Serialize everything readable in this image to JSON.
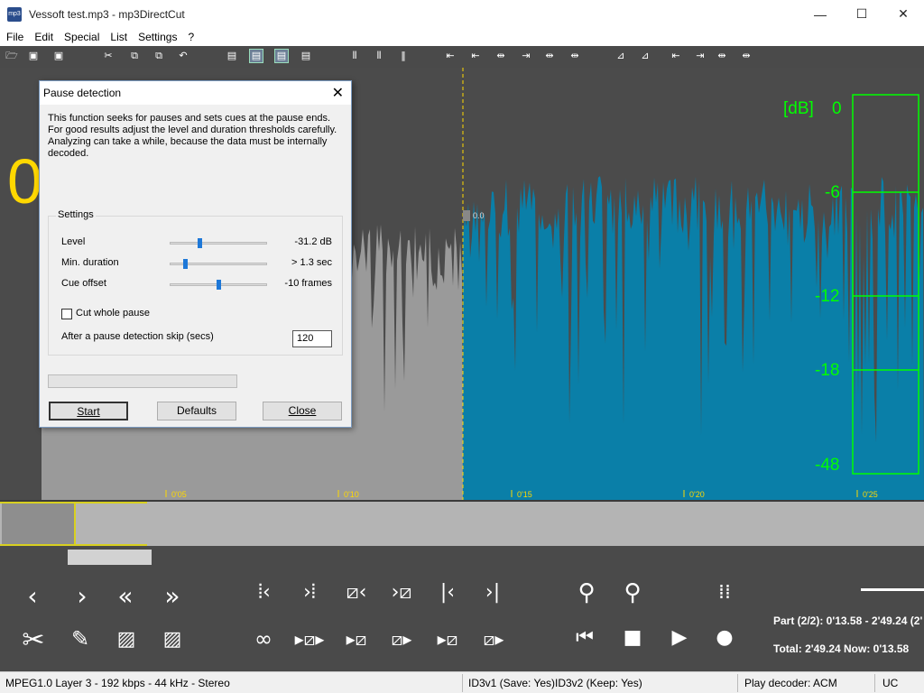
{
  "window": {
    "title": "Vessoft test.mp3 - mp3DirectCut",
    "app_icon": "mp3",
    "minimize": "—",
    "maximize": "☐",
    "close": "✕"
  },
  "menu": [
    "File",
    "Edit",
    "Special",
    "List",
    "Settings",
    "?"
  ],
  "timeline": {
    "cue_label": "0.0",
    "ticks": [
      "0'05",
      "0'10",
      "0'15",
      "0'20",
      "0'25"
    ]
  },
  "vu": {
    "unit": "[dB]",
    "labels": [
      "0",
      "-6",
      "-12",
      "-18",
      "-48"
    ],
    "color": "#00ff00"
  },
  "dialog": {
    "title": "Pause detection",
    "description": "This function seeks for pauses and sets cues at the pause ends. For good results adjust the level and duration thresholds carefully. Analyzing can take a while, because the data must be internally decoded.",
    "settings_label": "Settings",
    "sliders": [
      {
        "label": "Level",
        "value": "-31.2 dB",
        "level": 0.3
      },
      {
        "label": "Min. duration",
        "value": "> 1.3 sec",
        "level": 0.15
      },
      {
        "label": "Cue offset",
        "value": "-10 frames",
        "level": 0.5
      }
    ],
    "cut_whole_pause": {
      "label": "Cut whole pause",
      "checked": false
    },
    "skip": {
      "label": "After a pause detection skip (secs)",
      "value": "120"
    },
    "buttons": {
      "start": "Start",
      "defaults": "Defaults",
      "close": "Close"
    }
  },
  "info": {
    "part": "Part (2/2): 0'13.58 - 2'49.24 (2'",
    "total": "Total: 2'49.24  Now: 0'13.58"
  },
  "status": {
    "format": "MPEG1.0 Layer 3 - 192 kbps - 44 kHz - Stereo",
    "id3v1": "ID3v1 (Save: Yes)",
    "id3v2": "ID3v2 (Keep: Yes)",
    "decoder": "Play decoder: ACM",
    "uc": "UC"
  },
  "colors": {
    "wave_selected": "#0a7fa8",
    "wave_unselected": "#9a9a9a",
    "cursor": "#ffd800",
    "background": "#4a4a4a"
  }
}
